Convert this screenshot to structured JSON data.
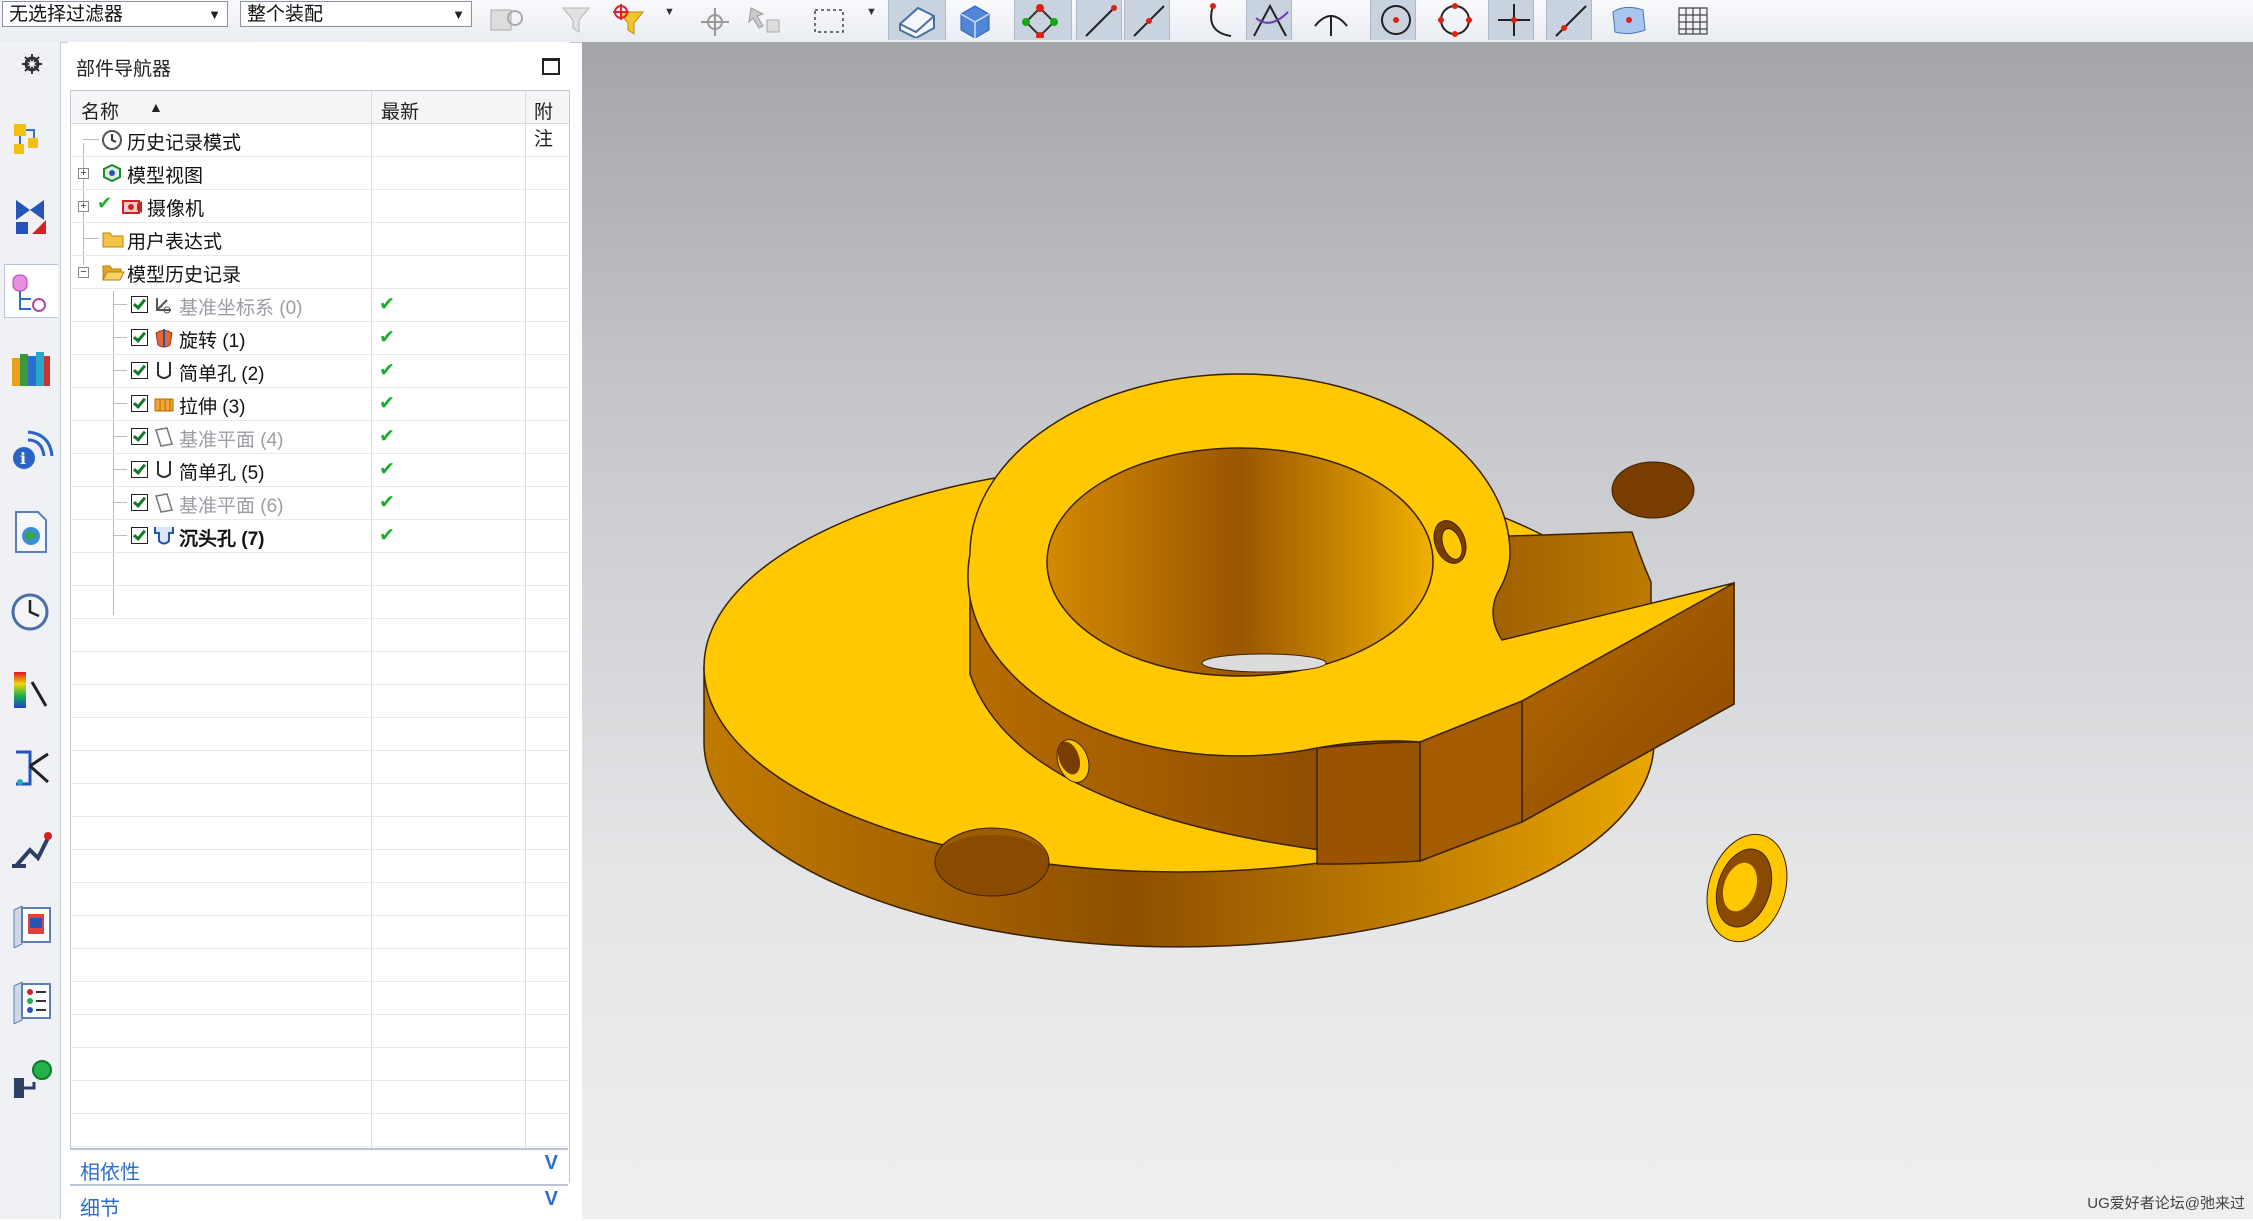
{
  "toolbar": {
    "filter_select": "无选择过滤器",
    "scope_select": "整个装配"
  },
  "navigator": {
    "title": "部件导航器",
    "columns": {
      "name": "名称",
      "latest": "最新",
      "notes": "附注"
    },
    "rows": [
      {
        "label": "历史记录模式",
        "icon": "clock-icon"
      },
      {
        "label": "模型视图",
        "icon": "model-views-icon"
      },
      {
        "label": "摄像机",
        "icon": "camera-icon"
      },
      {
        "label": "用户表达式",
        "icon": "folder-icon"
      },
      {
        "label": "模型历史记录",
        "icon": "folder-open-icon"
      },
      {
        "label": "基准坐标系 (0)",
        "icon": "datum-csys-icon",
        "latest": "✔"
      },
      {
        "label": "旋转 (1)",
        "icon": "revolve-icon",
        "latest": "✔"
      },
      {
        "label": "简单孔 (2)",
        "icon": "simple-hole-icon",
        "latest": "✔"
      },
      {
        "label": "拉伸 (3)",
        "icon": "extrude-icon",
        "latest": "✔"
      },
      {
        "label": "基准平面 (4)",
        "icon": "datum-plane-icon",
        "latest": "✔"
      },
      {
        "label": "简单孔 (5)",
        "icon": "simple-hole-icon",
        "latest": "✔"
      },
      {
        "label": "基准平面 (6)",
        "icon": "datum-plane-icon",
        "latest": "✔"
      },
      {
        "label": "沉头孔 (7)",
        "icon": "counterbore-hole-icon",
        "latest": "✔"
      }
    ],
    "panels": {
      "dependencies": "相依性",
      "details": "细节",
      "chevron": "V"
    }
  },
  "colors": {
    "part": "#ffc800",
    "part_shadow": "#a55c00",
    "check": "#1eae2e",
    "panel_link": "#2b6fc9"
  },
  "watermark": "UG爱好者论坛@弛来过"
}
